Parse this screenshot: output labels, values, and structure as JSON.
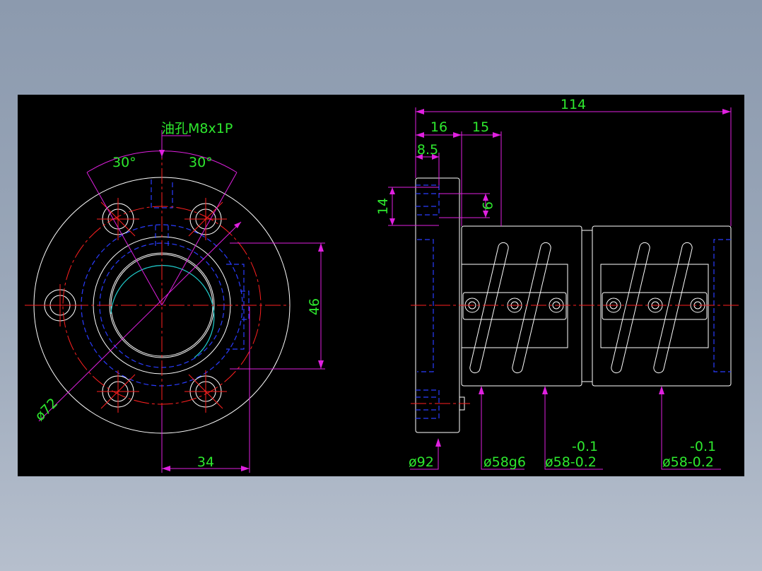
{
  "front_view": {
    "oil_hole": "油孔M8x1P",
    "angle_left": "30°",
    "angle_right": "30°",
    "dim_46": "46",
    "dim_34": "34",
    "dim_phi72": "ø72"
  },
  "side_view": {
    "dim_114": "114",
    "dim_16": "16",
    "dim_15": "15",
    "dim_8_5": "8.5",
    "dim_14": "14",
    "dim_9": "9",
    "dim_phi92": "ø92",
    "dim_phi58g6": "ø58g6",
    "dim_phi58_a": "ø58-0.2",
    "tol_a": "-0.1",
    "dim_phi58_b": "ø58-0.2",
    "tol_b": "-0.1"
  },
  "colors": {
    "background": "#000000",
    "outline": "#ffffff",
    "hidden": "#2a3cff",
    "center": "#ff2020",
    "dimension": "#e020e0",
    "text": "#2ee82e",
    "thread": "#20d0d0"
  }
}
